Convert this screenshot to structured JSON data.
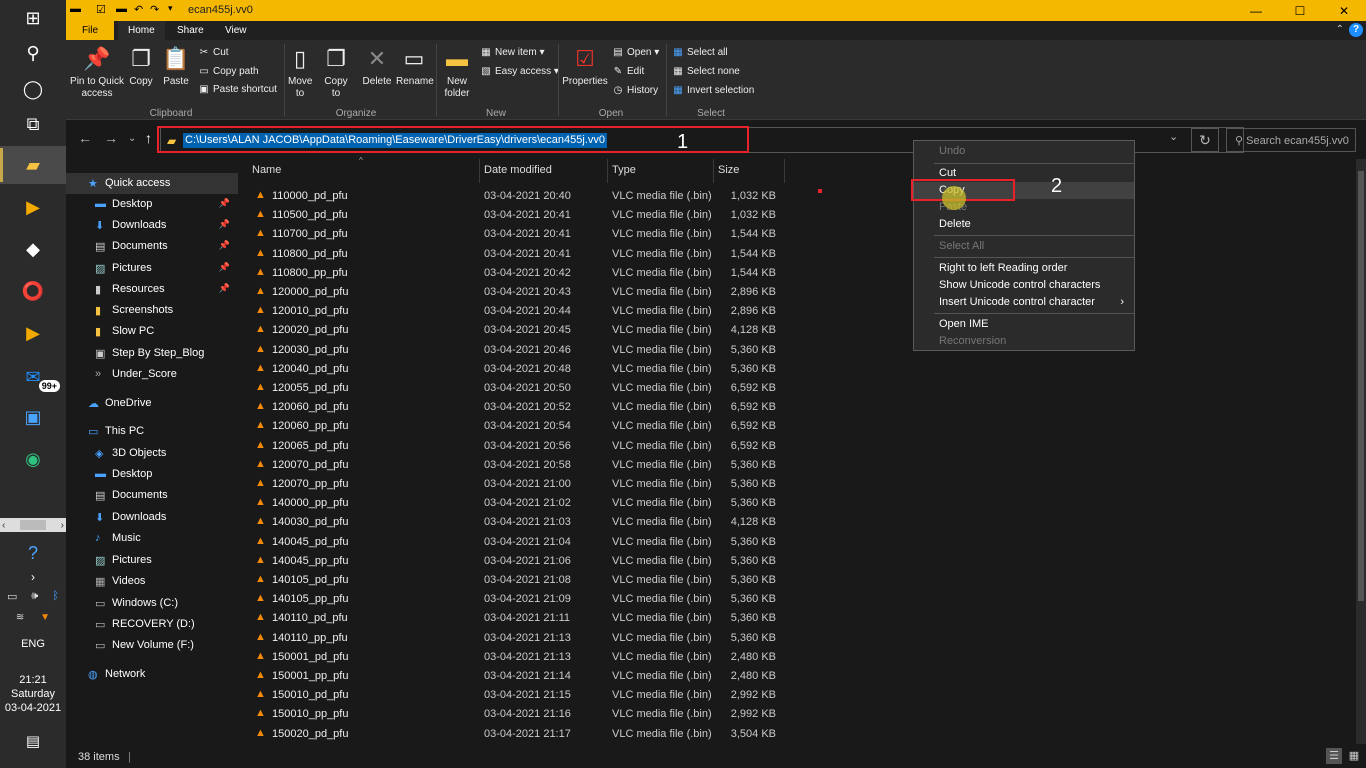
{
  "window": {
    "title": "ecan455j.vv0",
    "controls": {
      "minimize": "—",
      "maximize": "☐",
      "close": "✕"
    }
  },
  "ribbon_tabs": [
    "File",
    "Home",
    "Share",
    "View"
  ],
  "ribbon": {
    "clipboard": {
      "pin_label": "Pin to Quick access",
      "copy_label": "Copy",
      "paste_label": "Paste",
      "cut_label": "Cut",
      "copy_path_label": "Copy path",
      "paste_shortcut_label": "Paste shortcut",
      "group_label": "Clipboard"
    },
    "organize": {
      "move_to_label": "Move to",
      "copy_to_label": "Copy to",
      "delete_label": "Delete",
      "rename_label": "Rename",
      "group_label": "Organize"
    },
    "new": {
      "new_folder_label": "New folder",
      "new_item_label": "New item",
      "easy_access_label": "Easy access",
      "group_label": "New"
    },
    "open": {
      "properties_label": "Properties",
      "open_label": "Open",
      "edit_label": "Edit",
      "history_label": "History",
      "group_label": "Open"
    },
    "select": {
      "select_all_label": "Select all",
      "select_none_label": "Select none",
      "invert_label": "Invert selection",
      "group_label": "Select"
    }
  },
  "address": {
    "path": "C:\\Users\\ALAN JACOB\\AppData\\Roaming\\Easeware\\DriverEasy\\drivers\\ecan455j.vv0",
    "search_placeholder": "Search ecan455j.vv0"
  },
  "annotations": {
    "label1": "1",
    "label2": "2"
  },
  "nav_pane": {
    "quick_access": "Quick access",
    "quick_items": [
      {
        "label": "Desktop",
        "pinned": true
      },
      {
        "label": "Downloads",
        "pinned": true
      },
      {
        "label": "Documents",
        "pinned": true
      },
      {
        "label": "Pictures",
        "pinned": true
      },
      {
        "label": "Resources",
        "pinned": true
      },
      {
        "label": "Screenshots",
        "pinned": false
      },
      {
        "label": "Slow PC",
        "pinned": false
      },
      {
        "label": "Step By Step_Blog",
        "pinned": false
      },
      {
        "label": "Under_Score",
        "pinned": false
      }
    ],
    "onedrive": "OneDrive",
    "this_pc": "This PC",
    "pc_items": [
      "3D Objects",
      "Desktop",
      "Documents",
      "Downloads",
      "Music",
      "Pictures",
      "Videos",
      "Windows (C:)",
      "RECOVERY (D:)",
      "New Volume (F:)"
    ],
    "network": "Network"
  },
  "columns": {
    "name": "Name",
    "date": "Date modified",
    "type": "Type",
    "size": "Size"
  },
  "files": [
    {
      "name": "110000_pd_pfu",
      "date": "03-04-2021 20:40",
      "type": "VLC media file (.bin)",
      "size": "1,032 KB"
    },
    {
      "name": "110500_pd_pfu",
      "date": "03-04-2021 20:41",
      "type": "VLC media file (.bin)",
      "size": "1,032 KB"
    },
    {
      "name": "110700_pd_pfu",
      "date": "03-04-2021 20:41",
      "type": "VLC media file (.bin)",
      "size": "1,544 KB"
    },
    {
      "name": "110800_pd_pfu",
      "date": "03-04-2021 20:41",
      "type": "VLC media file (.bin)",
      "size": "1,544 KB"
    },
    {
      "name": "110800_pp_pfu",
      "date": "03-04-2021 20:42",
      "type": "VLC media file (.bin)",
      "size": "1,544 KB"
    },
    {
      "name": "120000_pd_pfu",
      "date": "03-04-2021 20:43",
      "type": "VLC media file (.bin)",
      "size": "2,896 KB"
    },
    {
      "name": "120010_pd_pfu",
      "date": "03-04-2021 20:44",
      "type": "VLC media file (.bin)",
      "size": "2,896 KB"
    },
    {
      "name": "120020_pd_pfu",
      "date": "03-04-2021 20:45",
      "type": "VLC media file (.bin)",
      "size": "4,128 KB"
    },
    {
      "name": "120030_pd_pfu",
      "date": "03-04-2021 20:46",
      "type": "VLC media file (.bin)",
      "size": "5,360 KB"
    },
    {
      "name": "120040_pd_pfu",
      "date": "03-04-2021 20:48",
      "type": "VLC media file (.bin)",
      "size": "5,360 KB"
    },
    {
      "name": "120055_pd_pfu",
      "date": "03-04-2021 20:50",
      "type": "VLC media file (.bin)",
      "size": "6,592 KB"
    },
    {
      "name": "120060_pd_pfu",
      "date": "03-04-2021 20:52",
      "type": "VLC media file (.bin)",
      "size": "6,592 KB"
    },
    {
      "name": "120060_pp_pfu",
      "date": "03-04-2021 20:54",
      "type": "VLC media file (.bin)",
      "size": "6,592 KB"
    },
    {
      "name": "120065_pd_pfu",
      "date": "03-04-2021 20:56",
      "type": "VLC media file (.bin)",
      "size": "6,592 KB"
    },
    {
      "name": "120070_pd_pfu",
      "date": "03-04-2021 20:58",
      "type": "VLC media file (.bin)",
      "size": "5,360 KB"
    },
    {
      "name": "120070_pp_pfu",
      "date": "03-04-2021 21:00",
      "type": "VLC media file (.bin)",
      "size": "5,360 KB"
    },
    {
      "name": "140000_pp_pfu",
      "date": "03-04-2021 21:02",
      "type": "VLC media file (.bin)",
      "size": "5,360 KB"
    },
    {
      "name": "140030_pd_pfu",
      "date": "03-04-2021 21:03",
      "type": "VLC media file (.bin)",
      "size": "4,128 KB"
    },
    {
      "name": "140045_pd_pfu",
      "date": "03-04-2021 21:04",
      "type": "VLC media file (.bin)",
      "size": "5,360 KB"
    },
    {
      "name": "140045_pp_pfu",
      "date": "03-04-2021 21:06",
      "type": "VLC media file (.bin)",
      "size": "5,360 KB"
    },
    {
      "name": "140105_pd_pfu",
      "date": "03-04-2021 21:08",
      "type": "VLC media file (.bin)",
      "size": "5,360 KB"
    },
    {
      "name": "140105_pp_pfu",
      "date": "03-04-2021 21:09",
      "type": "VLC media file (.bin)",
      "size": "5,360 KB"
    },
    {
      "name": "140110_pd_pfu",
      "date": "03-04-2021 21:11",
      "type": "VLC media file (.bin)",
      "size": "5,360 KB"
    },
    {
      "name": "140110_pp_pfu",
      "date": "03-04-2021 21:13",
      "type": "VLC media file (.bin)",
      "size": "5,360 KB"
    },
    {
      "name": "150001_pd_pfu",
      "date": "03-04-2021 21:13",
      "type": "VLC media file (.bin)",
      "size": "2,480 KB"
    },
    {
      "name": "150001_pp_pfu",
      "date": "03-04-2021 21:14",
      "type": "VLC media file (.bin)",
      "size": "2,480 KB"
    },
    {
      "name": "150010_pd_pfu",
      "date": "03-04-2021 21:15",
      "type": "VLC media file (.bin)",
      "size": "2,992 KB"
    },
    {
      "name": "150010_pp_pfu",
      "date": "03-04-2021 21:16",
      "type": "VLC media file (.bin)",
      "size": "2,992 KB"
    },
    {
      "name": "150020_pd_pfu",
      "date": "03-04-2021 21:17",
      "type": "VLC media file (.bin)",
      "size": "3,504 KB"
    }
  ],
  "context_menu": {
    "undo": "Undo",
    "cut": "Cut",
    "copy": "Copy",
    "paste": "Paste",
    "delete": "Delete",
    "select_all": "Select All",
    "rtl": "Right to left Reading order",
    "show_unicode": "Show Unicode control characters",
    "insert_unicode": "Insert Unicode control character",
    "open_ime": "Open IME",
    "reconversion": "Reconversion"
  },
  "status": {
    "items": "38 items"
  },
  "taskbar": {
    "mail_badge": "99+",
    "lang": "ENG",
    "time": "21:21",
    "day": "Saturday",
    "date": "03-04-2021"
  },
  "colors": {
    "accent": "#f5b800",
    "selection": "#0063b1",
    "annotation": "#e8222b"
  }
}
